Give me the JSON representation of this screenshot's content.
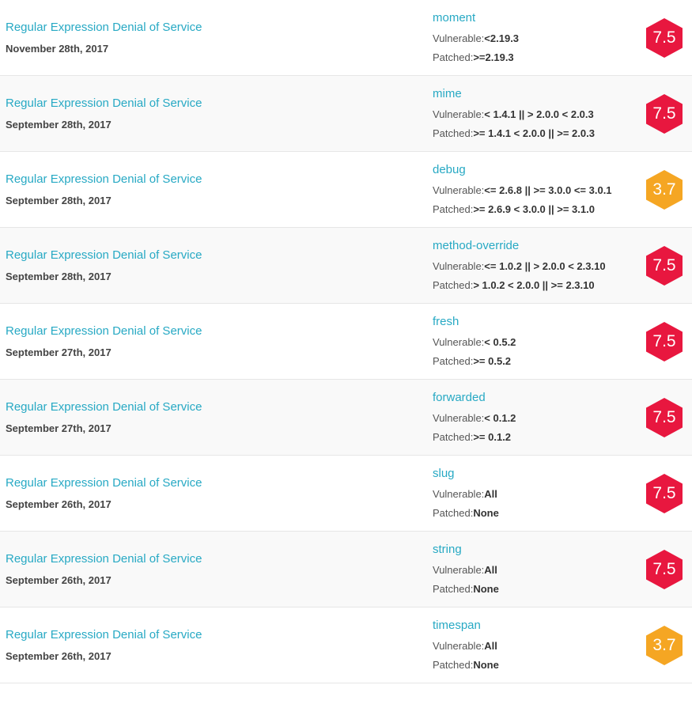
{
  "colors": {
    "link": "#27a9c4",
    "high": "#e8173f",
    "medium": "#f5a623"
  },
  "vulnerabilities": [
    {
      "title": "Regular Expression Denial of Service",
      "date": "November 28th, 2017",
      "package": "moment",
      "vulnerable_label": "Vulnerable:",
      "vulnerable": "<2.19.3",
      "patched_label": "Patched:",
      "patched": ">=2.19.3",
      "score": "7.5",
      "severity": "high"
    },
    {
      "title": "Regular Expression Denial of Service",
      "date": "September 28th, 2017",
      "package": "mime",
      "vulnerable_label": "Vulnerable:",
      "vulnerable": "< 1.4.1 || > 2.0.0 < 2.0.3",
      "patched_label": "Patched:",
      "patched": ">= 1.4.1 < 2.0.0 || >= 2.0.3",
      "score": "7.5",
      "severity": "high"
    },
    {
      "title": "Regular Expression Denial of Service",
      "date": "September 28th, 2017",
      "package": "debug",
      "vulnerable_label": "Vulnerable:",
      "vulnerable": "<= 2.6.8 || >= 3.0.0 <= 3.0.1",
      "patched_label": "Patched:",
      "patched": ">= 2.6.9 < 3.0.0 || >= 3.1.0",
      "score": "3.7",
      "severity": "medium"
    },
    {
      "title": "Regular Expression Denial of Service",
      "date": "September 28th, 2017",
      "package": "method-override",
      "vulnerable_label": "Vulnerable:",
      "vulnerable": "<= 1.0.2 || > 2.0.0 < 2.3.10",
      "patched_label": "Patched:",
      "patched": "> 1.0.2 < 2.0.0 || >= 2.3.10",
      "score": "7.5",
      "severity": "high"
    },
    {
      "title": "Regular Expression Denial of Service",
      "date": "September 27th, 2017",
      "package": "fresh",
      "vulnerable_label": "Vulnerable:",
      "vulnerable": "< 0.5.2",
      "patched_label": "Patched:",
      "patched": ">= 0.5.2",
      "score": "7.5",
      "severity": "high"
    },
    {
      "title": "Regular Expression Denial of Service",
      "date": "September 27th, 2017",
      "package": "forwarded",
      "vulnerable_label": "Vulnerable:",
      "vulnerable": "< 0.1.2",
      "patched_label": "Patched:",
      "patched": ">= 0.1.2",
      "score": "7.5",
      "severity": "high"
    },
    {
      "title": "Regular Expression Denial of Service",
      "date": "September 26th, 2017",
      "package": "slug",
      "vulnerable_label": "Vulnerable:",
      "vulnerable": "All",
      "patched_label": "Patched:",
      "patched": "None",
      "score": "7.5",
      "severity": "high"
    },
    {
      "title": "Regular Expression Denial of Service",
      "date": "September 26th, 2017",
      "package": "string",
      "vulnerable_label": "Vulnerable:",
      "vulnerable": "All",
      "patched_label": "Patched:",
      "patched": "None",
      "score": "7.5",
      "severity": "high"
    },
    {
      "title": "Regular Expression Denial of Service",
      "date": "September 26th, 2017",
      "package": "timespan",
      "vulnerable_label": "Vulnerable:",
      "vulnerable": "All",
      "patched_label": "Patched:",
      "patched": "None",
      "score": "3.7",
      "severity": "medium"
    }
  ]
}
